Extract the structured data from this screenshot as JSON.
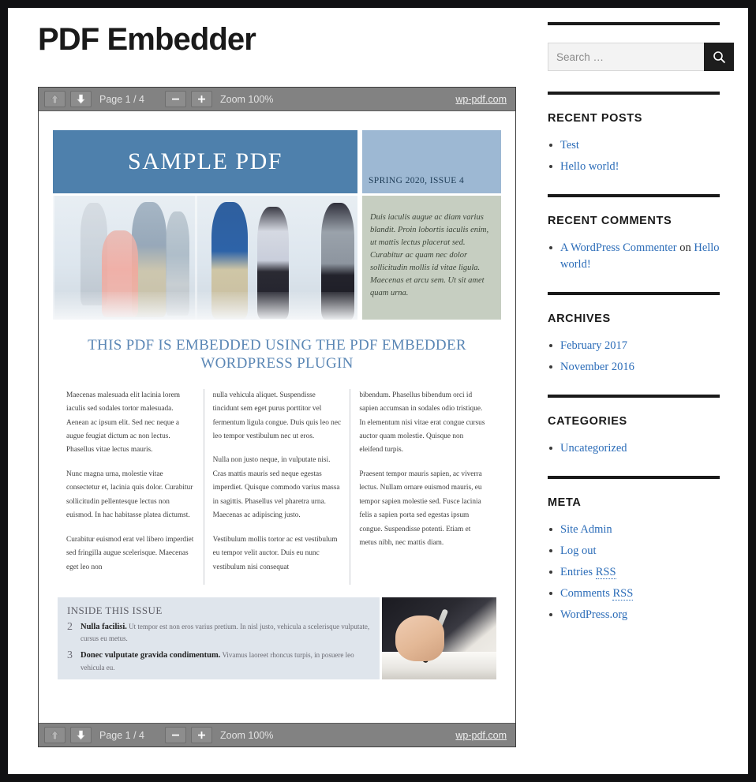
{
  "site": {
    "title": "PDF Embedder"
  },
  "viewer": {
    "toolbar": {
      "prev_icon": "arrow-up-icon",
      "next_icon": "arrow-down-icon",
      "page_label": "Page 1 / 4",
      "zoom_out_label": "−",
      "zoom_in_label": "+",
      "zoom_label": "Zoom 100%",
      "brand_link": "wp-pdf.com"
    },
    "document": {
      "masthead_title": "SAMPLE PDF",
      "masthead_issue": "SPRING 2020, ISSUE 4",
      "sidebar_note": "Duis iaculis augue ac diam varius blandit. Proin lobortis iaculis enim, ut mattis lectus placerat sed. Curabitur ac quam nec dolor sollicitudin mollis id vitae ligula. Maecenas et arcu sem. Ut sit amet quam urna.",
      "headline": "THIS PDF IS EMBEDDED USING THE PDF EMBEDDER WORDPRESS PLUGIN",
      "columns": [
        {
          "paragraphs": [
            "Maecenas malesuada elit lacinia lorem iaculis sed sodales tortor malesuada. Aenean ac ipsum elit. Sed nec neque a augue feugiat dictum ac non lectus. Phasellus vitae lectus mauris.",
            "Nunc magna urna, molestie vitae consectetur et, lacinia quis dolor. Curabitur sollicitudin pellentesque lectus non euismod. In hac habitasse platea dictumst.",
            "Curabitur euismod erat vel libero imperdiet sed fringilla augue scelerisque. Maecenas eget leo non"
          ]
        },
        {
          "paragraphs": [
            "nulla vehicula aliquet. Suspendisse tincidunt sem eget purus porttitor vel fermentum ligula congue. Duis quis leo nec leo tempor vestibulum nec ut eros.",
            "Nulla non justo neque, in vulputate nisi. Cras mattis mauris sed neque egestas imperdiet. Quisque commodo varius massa in sagittis. Phasellus vel pharetra urna. Maecenas ac adipiscing justo.",
            "Vestibulum mollis tortor ac est vestibulum eu tempor velit auctor. Duis eu nunc vestibulum nisi consequat"
          ]
        },
        {
          "paragraphs": [
            "bibendum. Phasellus bibendum orci id sapien accumsan in sodales odio tristique. In elementum nisi vitae erat congue cursus auctor quam molestie. Quisque non eleifend turpis.",
            "Praesent tempor mauris sapien, ac viverra lectus. Nullam ornare euismod mauris, eu tempor sapien molestie sed. Fusce lacinia felis a sapien porta sed egestas ipsum congue. Suspendisse potenti. Etiam et metus nibh, nec mattis diam."
          ]
        }
      ],
      "inside_this_issue": {
        "title": "INSIDE THIS ISSUE",
        "items": [
          {
            "number": "2",
            "heading": "Nulla facilisi.",
            "text": "Ut tempor est non eros varius pretium. In nisl justo, vehicula a scelerisque vulputate, cursus eu metus."
          },
          {
            "number": "3",
            "heading": "Donec vulputate gravida condimentum.",
            "text": "Vivamus laoreet rhoncus turpis, in posuere leo vehicula eu."
          }
        ]
      }
    }
  },
  "sidebar": {
    "search": {
      "placeholder": "Search …",
      "value": "",
      "button_icon": "search-icon"
    },
    "widgets": [
      {
        "title": "Recent Posts",
        "items": [
          {
            "parts": [
              {
                "text": "Test",
                "link": true
              }
            ]
          },
          {
            "parts": [
              {
                "text": "Hello world!",
                "link": true
              }
            ]
          }
        ]
      },
      {
        "title": "Recent Comments",
        "items": [
          {
            "parts": [
              {
                "text": "A WordPress Commenter",
                "link": true
              },
              {
                "text": " on ",
                "link": false
              },
              {
                "text": "Hello world!",
                "link": true
              }
            ]
          }
        ]
      },
      {
        "title": "Archives",
        "items": [
          {
            "parts": [
              {
                "text": "February 2017",
                "link": true
              }
            ]
          },
          {
            "parts": [
              {
                "text": "November 2016",
                "link": true
              }
            ]
          }
        ]
      },
      {
        "title": "Categories",
        "items": [
          {
            "parts": [
              {
                "text": "Uncategorized",
                "link": true
              }
            ]
          }
        ]
      },
      {
        "title": "Meta",
        "items": [
          {
            "parts": [
              {
                "text": "Site Admin",
                "link": true
              }
            ]
          },
          {
            "parts": [
              {
                "text": "Log out",
                "link": true
              }
            ]
          },
          {
            "parts": [
              {
                "text": "Entries ",
                "link": true
              },
              {
                "text": "RSS",
                "link": true,
                "abbr": true
              }
            ]
          },
          {
            "parts": [
              {
                "text": "Comments ",
                "link": true
              },
              {
                "text": "RSS",
                "link": true,
                "abbr": true
              }
            ]
          },
          {
            "parts": [
              {
                "text": "WordPress.org",
                "link": true
              }
            ]
          }
        ]
      }
    ]
  },
  "colors": {
    "accent_link": "#2b6cb8",
    "masthead_blue": "#4e80ac",
    "masthead_light_blue": "#9db8d3",
    "toolbar_gray": "#828282",
    "page_border": "#111113"
  }
}
